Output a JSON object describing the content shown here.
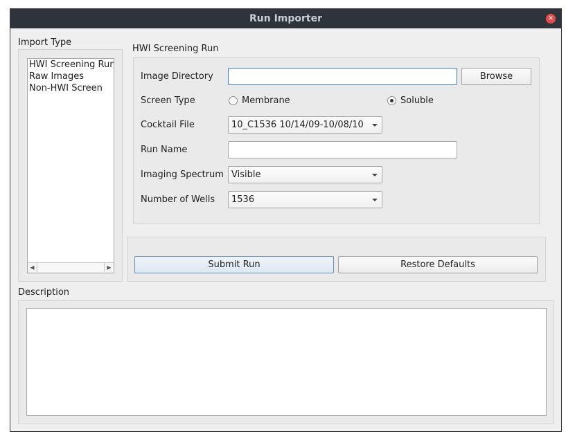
{
  "window": {
    "title": "Run Importer"
  },
  "import_type": {
    "label": "Import Type",
    "items": [
      "HWI Screening Run",
      "Raw Images",
      "Non-HWI Screen"
    ]
  },
  "form": {
    "group_title": "HWI Screening Run",
    "image_directory": {
      "label": "Image Directory",
      "value": "",
      "browse_label": "Browse"
    },
    "screen_type": {
      "label": "Screen Type",
      "option_membrane": "Membrane",
      "option_soluble": "Soluble",
      "selected": "Soluble"
    },
    "cocktail_file": {
      "label": "Cocktail File",
      "value": "10_C1536 10/14/09-10/08/10"
    },
    "run_name": {
      "label": "Run Name",
      "value": ""
    },
    "imaging_spectrum": {
      "label": "Imaging Spectrum",
      "value": "Visible"
    },
    "number_of_wells": {
      "label": "Number of Wells",
      "value": "1536"
    }
  },
  "actions": {
    "submit_label": "Submit Run",
    "restore_label": "Restore Defaults"
  },
  "description": {
    "label": "Description",
    "value": ""
  },
  "colors": {
    "titlebar": "#2f343a",
    "close": "#e14d4d",
    "focus": "#3d7fb8",
    "window_bg": "#efefef"
  }
}
